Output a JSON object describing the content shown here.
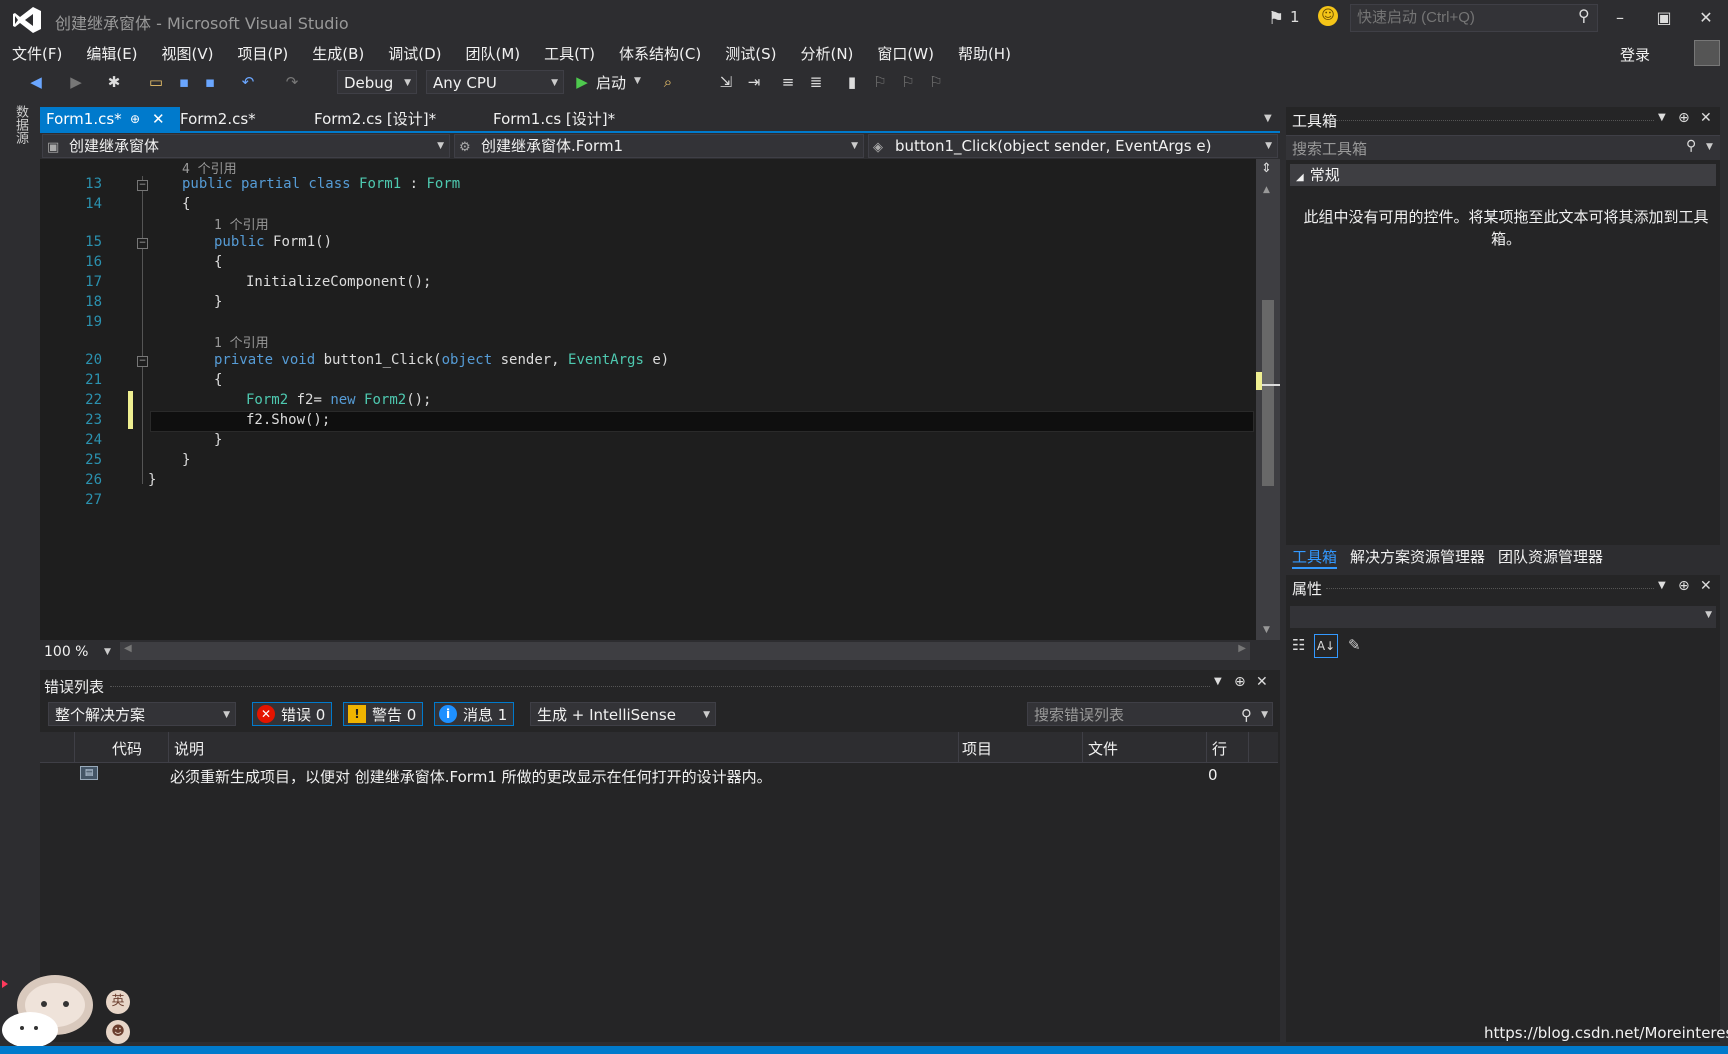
{
  "window": {
    "title": "创建继承窗体 - Microsoft Visual Studio",
    "notification_count": "1",
    "quick_launch_placeholder": "快速启动 (Ctrl+Q)",
    "signin": "登录"
  },
  "menu": [
    "文件(F)",
    "编辑(E)",
    "视图(V)",
    "项目(P)",
    "生成(B)",
    "调试(D)",
    "团队(M)",
    "工具(T)",
    "体系结构(C)",
    "测试(S)",
    "分析(N)",
    "窗口(W)",
    "帮助(H)"
  ],
  "toolbar": {
    "config": "Debug",
    "platform": "Any CPU",
    "start_label": "启动"
  },
  "left_strip": {
    "datasource": "数据源"
  },
  "tabs": [
    {
      "label": "Form1.cs*",
      "active": true
    },
    {
      "label": "Form2.cs*",
      "active": false
    },
    {
      "label": "Form2.cs [设计]*",
      "active": false
    },
    {
      "label": "Form1.cs [设计]*",
      "active": false
    }
  ],
  "navbar": {
    "project": "创建继承窗体",
    "type": "创建继承窗体.Form1",
    "member": "button1_Click(object sender, EventArgs e)"
  },
  "editor": {
    "refs_4": "4 个引用",
    "refs_1a": "1 个引用",
    "refs_1b": "1 个引用",
    "lines": {
      "n13": "13",
      "n14": "14",
      "n15": "15",
      "n16": "16",
      "n17": "17",
      "n18": "18",
      "n19": "19",
      "n20": "20",
      "n21": "21",
      "n22": "22",
      "n23": "23",
      "n24": "24",
      "n25": "25",
      "n26": "26",
      "n27": "27"
    },
    "code": {
      "l13_kw": "public partial class ",
      "l13_name": "Form1",
      "l13_sep": " : ",
      "l13_base": "Form",
      "l14": "{",
      "l15_kw": "public ",
      "l15_rest": "Form1()",
      "l16": "{",
      "l17": "InitializeComponent();",
      "l18": "}",
      "l20_kw": "private void ",
      "l20_name": "button1_Click(",
      "l20_obj": "object",
      "l20_sender": " sender, ",
      "l20_type": "EventArgs",
      "l20_end": " e)",
      "l21": "{",
      "l22_type": "Form2",
      "l22_mid": " f2= ",
      "l22_new": "new ",
      "l22_type2": "Form2",
      "l22_end": "();",
      "l23": "f2.Show();",
      "l24": "}",
      "l25": "}",
      "l26": "}"
    },
    "zoom": "100 %"
  },
  "error_list": {
    "title": "错误列表",
    "scope": "整个解决方案",
    "errors": "错误 0",
    "warnings": "警告 0",
    "messages": "消息 1",
    "filter": "生成 + IntelliSense",
    "search_placeholder": "搜索错误列表",
    "columns": {
      "code": "代码",
      "desc": "说明",
      "project": "项目",
      "file": "文件",
      "line": "行"
    },
    "rows": [
      {
        "description": "必须重新生成项目，以便对 创建继承窗体.Form1 所做的更改显示在任何打开的设计器内。",
        "line": "0"
      }
    ]
  },
  "toolbox": {
    "title": "工具箱",
    "search_placeholder": "搜索工具箱",
    "group": "常规",
    "empty_msg_1": "此组中没有可用的控件。将某项拖至此文本可将其添加到工具",
    "empty_msg_2": "箱。"
  },
  "right_tabs": [
    "工具箱",
    "解决方案资源管理器",
    "团队资源管理器"
  ],
  "properties": {
    "title": "属性"
  },
  "ime": {
    "lang": "英"
  },
  "watermark": "https://blog.csdn.net/Moreinterest",
  "colors": {
    "accent": "#007acc",
    "keyword": "#569cd6",
    "type": "#4ec9b0",
    "line_number": "#2b91af"
  }
}
